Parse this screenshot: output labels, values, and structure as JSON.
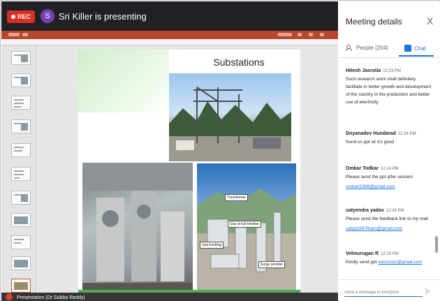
{
  "topbar": {
    "rec_label": "REC",
    "avatar_initial": "S",
    "presenting_text": "Sri Killer is presenting"
  },
  "slide": {
    "title": "Substations",
    "labels": {
      "transformer": "Transformer",
      "gas_circuit_breaker": "Gas circuit breaker",
      "gas_bushing": "Gas bushing",
      "surge_arrester": "Surge arrester"
    }
  },
  "status_bar": {
    "presenter_text": "Presentation (Dr Subba Reddy)"
  },
  "panel": {
    "title": "Meeting details",
    "close_glyph": "X",
    "tabs": {
      "people_label": "People (204)",
      "chat_label": "Chat"
    },
    "messages": [
      {
        "sender": "Hitesh Jasrotia",
        "time": "12:23 PM",
        "text": "Such research work shall definitely facilitate in better growth and development of the country in the production and better use of electricity."
      },
      {
        "sender": "Dnyanadev Hundarad",
        "time": "12:24 PM",
        "text": "Send us ppt sir it's good"
      },
      {
        "sender": "Omkar Todkar",
        "time": "12:24 PM",
        "text": "Please send the ppt after session",
        "link": "omkart1999@gmail.com"
      },
      {
        "sender": "satyendra yadav",
        "time": "12:24 PM",
        "text": "Please send the feedback link to my mail",
        "link": "satya1997tharu@gmail.com"
      },
      {
        "sender": "Velmurugan R",
        "time": "12:24 PM",
        "text": "Kindly send ppt",
        "link": "velsvictor@gmail.com"
      }
    ],
    "input_placeholder": "Send a message to everyone"
  },
  "colors": {
    "rec_red": "#d93025",
    "accent_blue": "#1a73e8",
    "ppt_orange": "#b7472a"
  }
}
